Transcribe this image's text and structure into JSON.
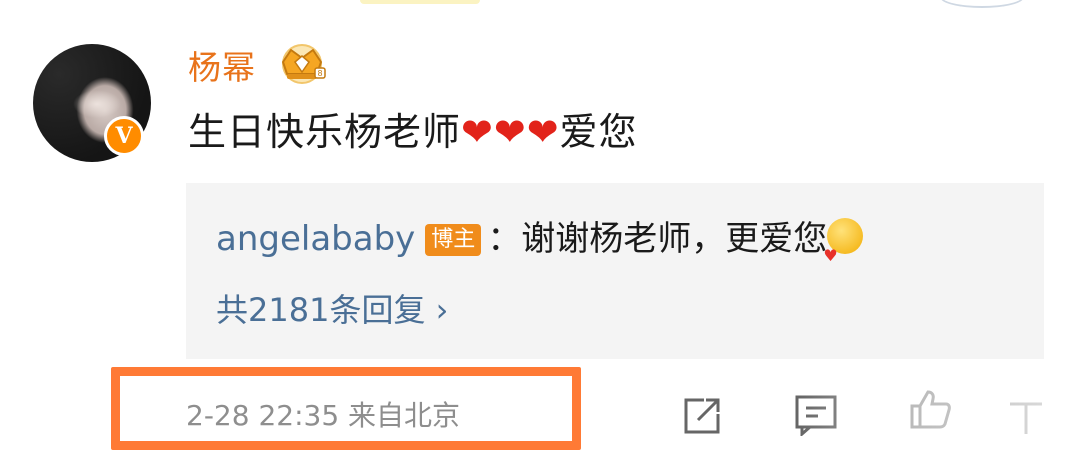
{
  "post": {
    "username": "杨幂",
    "content_prefix": "生日快乐杨老师",
    "hearts": "❤❤❤",
    "content_suffix": "爱您",
    "user_badge": "V"
  },
  "reply": {
    "user": "angelababy",
    "host_badge": "博主",
    "text": "：谢谢杨老师，更爱您",
    "emoji": "smiling-face-with-heart-emoji",
    "more_replies": "共2181条回复 ›"
  },
  "footer": {
    "timestamp": "2-28 22:35  来自北京",
    "highlight_color": "#ff7a35",
    "icons": [
      "share-icon",
      "comment-icon",
      "like-icon",
      "more-icon"
    ]
  },
  "colors": {
    "username": "#e8731b",
    "link": "#4a6f96",
    "heart": "#e2231a",
    "verified_badge": "#ff8c00"
  }
}
